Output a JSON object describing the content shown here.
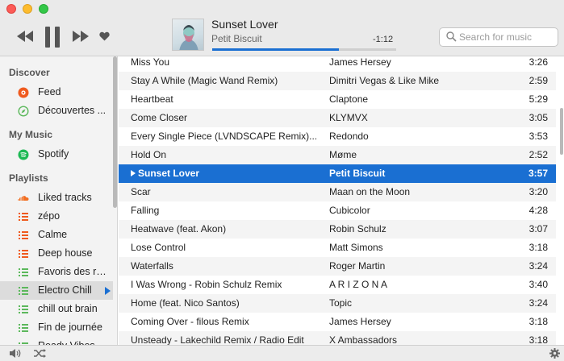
{
  "now_playing": {
    "title": "Sunset Lover",
    "artist": "Petit Biscuit",
    "remaining": "-1:12",
    "progress_fraction": 0.69
  },
  "search": {
    "placeholder": "Search for music"
  },
  "sidebar": {
    "sections": [
      {
        "title": "Discover"
      },
      {
        "title": "My Music"
      },
      {
        "title": "Playlists"
      }
    ],
    "items": [
      {
        "label": "Feed",
        "icon": "soundcloud-feed-icon",
        "color": "#ef5a1e"
      },
      {
        "label": "Découvertes ...",
        "icon": "compass-icon",
        "color": "#5cb85c"
      },
      {
        "label": "Spotify",
        "icon": "spotify-icon",
        "color": "#1db954"
      },
      {
        "label": "Liked tracks",
        "icon": "soundcloud-icon",
        "color": "#f26f23"
      },
      {
        "label": "zépo",
        "icon": "playlist-icon",
        "color": "#ef5a1e"
      },
      {
        "label": "Calme",
        "icon": "playlist-icon",
        "color": "#ef5a1e"
      },
      {
        "label": "Deep house",
        "icon": "playlist-icon",
        "color": "#ef5a1e"
      },
      {
        "label": "Favoris des ra...",
        "icon": "playlist-icon",
        "color": "#5cb85c"
      },
      {
        "label": "Electro Chill",
        "icon": "playlist-icon",
        "color": "#5cb85c"
      },
      {
        "label": "chill out brain",
        "icon": "playlist-icon",
        "color": "#5cb85c"
      },
      {
        "label": "Fin de journée",
        "icon": "playlist-icon",
        "color": "#5cb85c"
      },
      {
        "label": "Ready Vibes",
        "icon": "playlist-icon",
        "color": "#5cb85c"
      }
    ]
  },
  "tracks": [
    {
      "title": "Miss You",
      "artist": "James Hersey",
      "duration": "3:26"
    },
    {
      "title": "Stay A While (Magic Wand Remix)",
      "artist": "Dimitri Vegas & Like Mike",
      "duration": "2:59"
    },
    {
      "title": "Heartbeat",
      "artist": "Claptone",
      "duration": "5:29"
    },
    {
      "title": "Come Closer",
      "artist": "KLYMVX",
      "duration": "3:05"
    },
    {
      "title": "Every Single Piece (LVNDSCAPE Remix)...",
      "artist": "Redondo",
      "duration": "3:53"
    },
    {
      "title": "Hold On",
      "artist": "Møme",
      "duration": "2:52"
    },
    {
      "title": "Sunset Lover",
      "artist": "Petit Biscuit",
      "duration": "3:57"
    },
    {
      "title": "Scar",
      "artist": "Maan on the Moon",
      "duration": "3:20"
    },
    {
      "title": "Falling",
      "artist": "Cubicolor",
      "duration": "4:28"
    },
    {
      "title": "Heatwave (feat. Akon)",
      "artist": "Robin Schulz",
      "duration": "3:07"
    },
    {
      "title": "Lose Control",
      "artist": "Matt Simons",
      "duration": "3:18"
    },
    {
      "title": "Waterfalls",
      "artist": "Roger Martin",
      "duration": "3:24"
    },
    {
      "title": "I Was Wrong - Robin Schulz Remix",
      "artist": "A R I Z O N A",
      "duration": "3:40"
    },
    {
      "title": "Home (feat. Nico Santos)",
      "artist": "Topic",
      "duration": "3:24"
    },
    {
      "title": "Coming Over - filous Remix",
      "artist": "James Hersey",
      "duration": "3:18"
    },
    {
      "title": "Unsteady - Lakechild Remix / Radio Edit",
      "artist": "X Ambassadors",
      "duration": "3:18"
    }
  ],
  "selected_track_index": 6,
  "active_playlist_index": 8,
  "colors": {
    "accent": "#1a6fd2"
  }
}
